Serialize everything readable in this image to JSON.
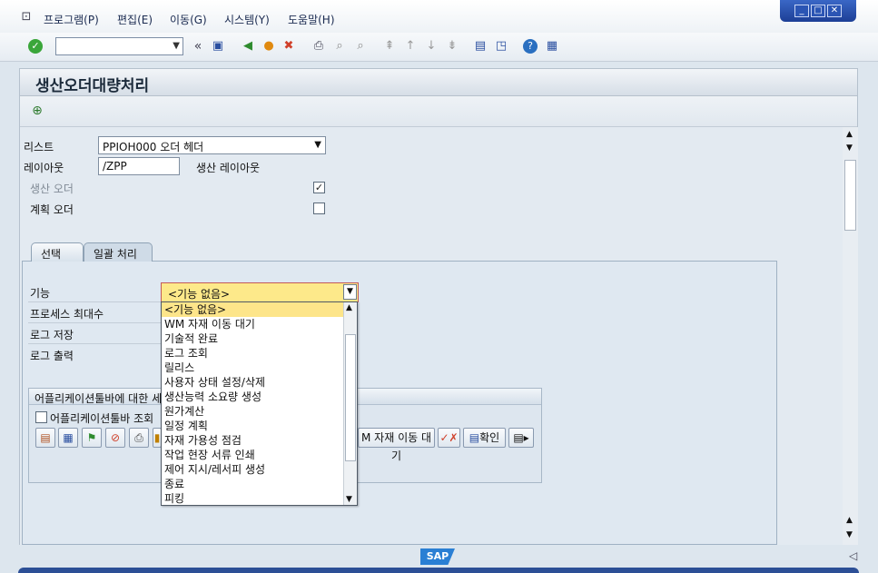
{
  "menu": [
    {
      "label": "프로그램(P)"
    },
    {
      "label": "편집(E)"
    },
    {
      "label": "이동(G)"
    },
    {
      "label": "시스템(Y)"
    },
    {
      "label": "도움말(H)"
    }
  ],
  "toolbar": {
    "command_value": "",
    "double_arrow": "«"
  },
  "page": {
    "title": "생산오더대량처리"
  },
  "form": {
    "list_label": "리스트",
    "list_value": "PPIOH000 오더 헤더",
    "layout_label": "레이아웃",
    "layout_value": "/ZPP",
    "layout_desc": "생산 레이아웃",
    "production_order_label": "생산 오더",
    "production_order_checked": true,
    "planned_order_label": "계획 오더",
    "planned_order_checked": false
  },
  "tabs": [
    {
      "label": "선택"
    },
    {
      "label": "일괄 처리"
    }
  ],
  "mass": {
    "function_label": "기능",
    "function_value": "<기능 없음>",
    "max_process_label": "프로세스 최대수",
    "log_save_label": "로그 저장",
    "log_output_label": "로그 출력"
  },
  "group": {
    "title": "어플리케이션툴바에 대한 세",
    "toolbar_display_label": "어플리케이션툴바 조회",
    "wm_button_label": "M 자재 이동 대기",
    "confirm_button_label": "확인"
  },
  "dropdown": {
    "items": [
      "<기능 없음>",
      "WM 자재 이동 대기",
      "기술적 완료",
      "로그 조회",
      "릴리스",
      "사용자 상태 설정/삭제",
      "생산능력 소요량 생성",
      "원가계산",
      "일정 계획",
      "자재 가용성 점검",
      "작업 현장 서류 인쇄",
      "제어 지시/레서피 생성",
      "종료",
      "피킹"
    ],
    "selected_index": 0
  },
  "status": {
    "logo": "SAP"
  },
  "colors": {
    "accent": "#2c4f96",
    "selected_field": "#fde98a"
  }
}
